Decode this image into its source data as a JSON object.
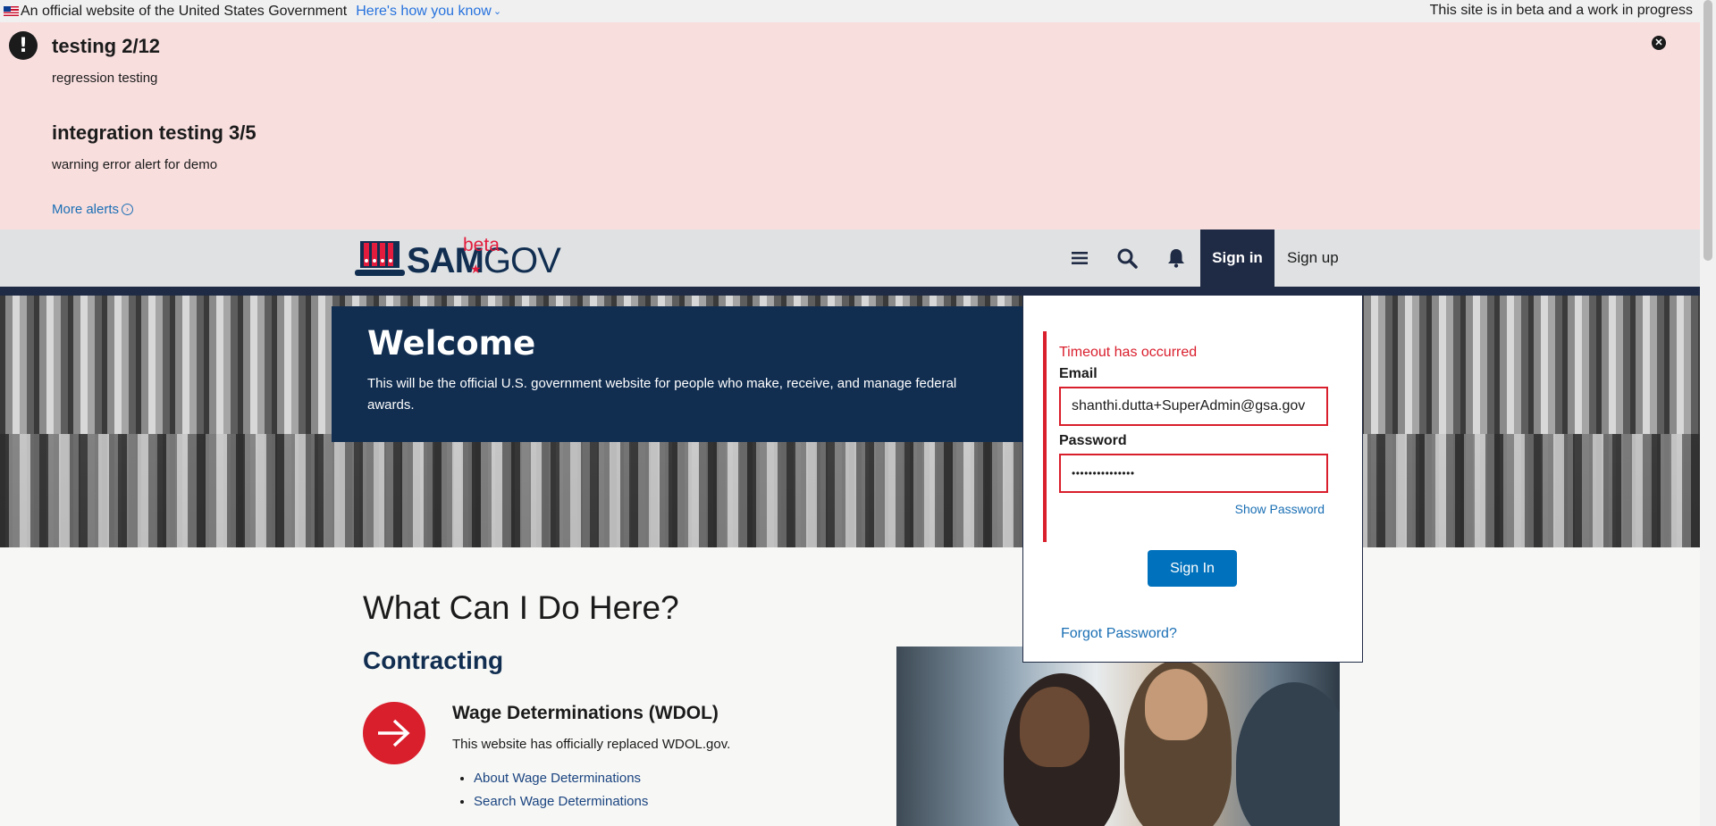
{
  "gov_banner": {
    "official_text": "An official website of the United States Government",
    "how_link": "Here's how you know",
    "beta_text": "This site is in beta and a work in progress"
  },
  "alerts": {
    "items": [
      {
        "title": "testing 2/12",
        "body": "regression testing"
      },
      {
        "title": "integration testing 3/5",
        "body": "warning error alert for demo"
      }
    ],
    "more_label": "More alerts",
    "color_background": "#f9dede"
  },
  "header": {
    "logo_main": "SAM",
    "logo_gov": "GOV",
    "logo_beta": "beta",
    "signin_label": "Sign in",
    "signup_label": "Sign up",
    "color_dark": "#1f2a44"
  },
  "hero": {
    "title": "Welcome",
    "text": "This will be the official U.S. government website for people who make, receive, and manage federal awards."
  },
  "content": {
    "heading": "What Can I Do Here?",
    "section": "Contracting",
    "card_title": "Wage Determinations (WDOL)",
    "card_text": "This website has officially replaced WDOL.gov.",
    "links": [
      "About Wage Determinations",
      "Search Wage Determinations"
    ]
  },
  "signin_form": {
    "error": "Timeout has occurred",
    "email_label": "Email",
    "email_value": "shanthi.dutta+SuperAdmin@gsa.gov",
    "password_label": "Password",
    "password_value": "•••••••••••••••",
    "show_password": "Show Password",
    "submit": "Sign In",
    "forgot": "Forgot Password?",
    "color_error": "#d91e2c",
    "color_primary": "#0071bc"
  }
}
